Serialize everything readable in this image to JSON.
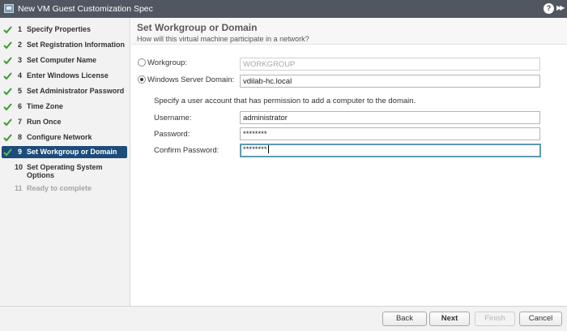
{
  "window": {
    "title": "New VM Guest Customization Spec",
    "help_label": "?",
    "expand_label": "▶▶"
  },
  "sidebar": {
    "steps": [
      {
        "num": "1",
        "label": "Specify Properties",
        "state": "done"
      },
      {
        "num": "2",
        "label": "Set Registration Information",
        "state": "done"
      },
      {
        "num": "3",
        "label": "Set Computer Name",
        "state": "done"
      },
      {
        "num": "4",
        "label": "Enter Windows License",
        "state": "done"
      },
      {
        "num": "5",
        "label": "Set Administrator Password",
        "state": "done"
      },
      {
        "num": "6",
        "label": "Time Zone",
        "state": "done"
      },
      {
        "num": "7",
        "label": "Run Once",
        "state": "done"
      },
      {
        "num": "8",
        "label": "Configure Network",
        "state": "done"
      },
      {
        "num": "9",
        "label": "Set Workgroup or Domain",
        "state": "active"
      },
      {
        "num": "10",
        "label": "Set Operating System Options",
        "state": "pending"
      },
      {
        "num": "11",
        "label": "Ready to complete",
        "state": "disabled"
      }
    ]
  },
  "page": {
    "title": "Set Workgroup or Domain",
    "subtitle": "How will this virtual machine participate in a network?"
  },
  "form": {
    "workgroup": {
      "label": "Workgroup:",
      "value": "WORKGROUP",
      "selected": false
    },
    "domain": {
      "label": "Windows Server Domain:",
      "value": "vdilab-hc.local",
      "selected": true
    },
    "account_hint": "Specify a user account that has permission to add a computer to the domain.",
    "username": {
      "label": "Username:",
      "value": "administrator"
    },
    "password": {
      "label": "Password:",
      "value": "********"
    },
    "confirm_password": {
      "label": "Confirm Password:",
      "value": "********"
    }
  },
  "footer": {
    "back": "Back",
    "next": "Next",
    "finish": "Finish",
    "cancel": "Cancel"
  },
  "colors": {
    "titlebar": "#515760",
    "active_step": "#1c4c79",
    "check": "#3d9a31"
  }
}
